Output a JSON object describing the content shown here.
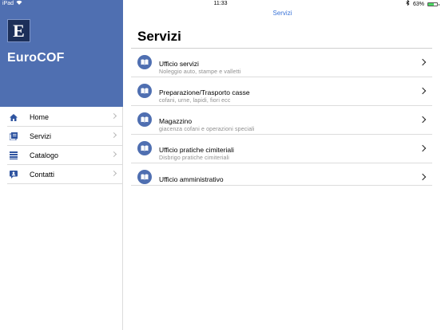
{
  "status_bar": {
    "device": "iPad",
    "time": "11:33",
    "battery": "63%",
    "battery_level": 0.63
  },
  "sidebar": {
    "logo_letter": "E",
    "brand": "EuroCOF",
    "items": [
      {
        "label": "Home",
        "icon": "home-icon"
      },
      {
        "label": "Servizi",
        "icon": "services-icon"
      },
      {
        "label": "Catalogo",
        "icon": "catalog-icon"
      },
      {
        "label": "Contatti",
        "icon": "contacts-icon"
      }
    ]
  },
  "main": {
    "nav_title": "Servizi",
    "page_title": "Servizi",
    "services": [
      {
        "title": "Ufficio servizi",
        "subtitle": "Noleggio auto, stampe e valletti"
      },
      {
        "title": "Preparazione/Trasporto casse",
        "subtitle": "cofani, urne, lapidi, fiori ecc"
      },
      {
        "title": "Magazzino",
        "subtitle": "giacenza cofani e operazioni speciali"
      },
      {
        "title": "Ufficio pratiche cimiteriali",
        "subtitle": "Disbrigo pratiche cimiteriali"
      },
      {
        "title": "Ufficio amministrativo",
        "subtitle": ""
      }
    ]
  },
  "colors": {
    "accent": "#4f6fb1",
    "link": "#3b74d8",
    "logo_bg": "#1c2f59"
  }
}
